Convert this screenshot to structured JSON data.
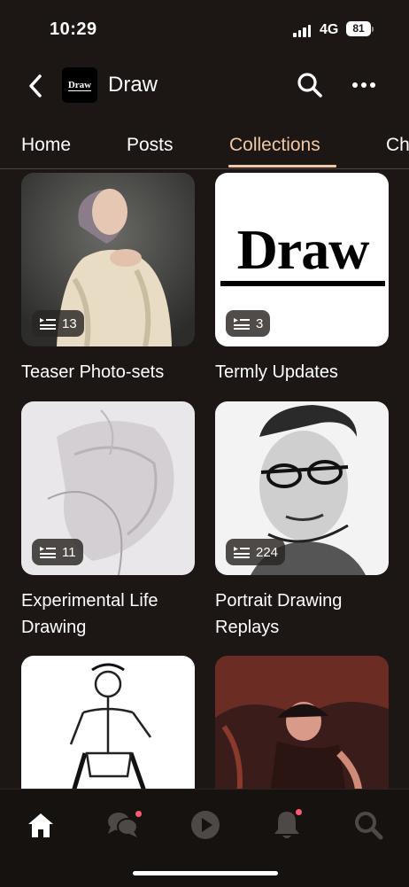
{
  "status": {
    "time": "10:29",
    "network": "4G",
    "battery": "81"
  },
  "header": {
    "logo_text": "Draw",
    "title": "Draw"
  },
  "tabs": [
    {
      "label": "Home"
    },
    {
      "label": "Posts"
    },
    {
      "label": "Collections",
      "active": true
    },
    {
      "label": "Ch"
    }
  ],
  "collections": [
    {
      "title": "Teaser Photo-sets",
      "count": "13"
    },
    {
      "title": "Termly Updates",
      "count": "3",
      "thumb_text": "Draw"
    },
    {
      "title": "Experimental Life Drawing",
      "count": "11"
    },
    {
      "title": "Portrait Drawing Replays",
      "count": "224"
    },
    {
      "title": "",
      "count": ""
    },
    {
      "title": "",
      "count": ""
    }
  ],
  "colors": {
    "accent": "#f1c8a5",
    "background": "#1c1715",
    "notification": "#ff5a6e"
  },
  "bottom_nav": [
    "home-icon",
    "chat-icon",
    "play-icon",
    "bell-icon",
    "search-icon"
  ]
}
